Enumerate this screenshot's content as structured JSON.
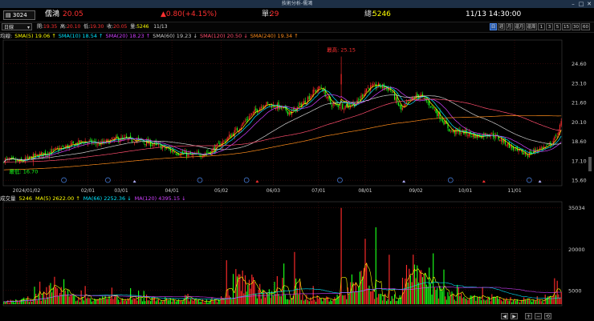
{
  "window": {
    "title": "技術分析-儒鴻",
    "buttons": [
      "–",
      "□",
      "✕"
    ]
  },
  "quote": {
    "symbol": "3024",
    "name": "儒鴻",
    "price": "20.05",
    "change": "▲0.80(+4.15%)",
    "unit_label": "單:",
    "unit_value": "29",
    "total_label": "總:",
    "total_value": "5246",
    "datetime": "11/13 14:30:00"
  },
  "ohlc": {
    "open_label": "開:",
    "open": "19.35",
    "high_label": "高:",
    "high": "20.10",
    "low_label": "低:",
    "low": "19.30",
    "close_label": "收:",
    "close": "20.05",
    "vol_label": "量:",
    "vol": "5246",
    "date": "11/13"
  },
  "toolbar": {
    "period": "日線",
    "period_arrow": "▾",
    "timeframes": [
      "日",
      "週",
      "月",
      "還月",
      "還周",
      "1",
      "3",
      "5",
      "15",
      "30",
      "60"
    ],
    "active": "日"
  },
  "price_legend": {
    "label": "均線:",
    "items": [
      {
        "text": "SMA(5) 19.06 ↑",
        "color": "#ffff00"
      },
      {
        "text": "SMA(10) 18.54 ↑",
        "color": "#00e5ff"
      },
      {
        "text": "SMA(20) 18.23 ↑",
        "color": "#d040ff"
      },
      {
        "text": "SMA(60) 19.23 ↓",
        "color": "#cccccc"
      },
      {
        "text": "SMA(120) 20.50 ↓",
        "color": "#ff4d6d"
      },
      {
        "text": "SMA(240) 19.34 ↑",
        "color": "#ff8c1a"
      }
    ]
  },
  "volume_legend": {
    "label": "成交量",
    "items": [
      {
        "text": "5246",
        "color": "#ffff00"
      },
      {
        "text": "MA(5) 2622.00 ↑",
        "color": "#ffff00"
      },
      {
        "text": "MA(66) 2252.36 ↓",
        "color": "#00e5ff"
      },
      {
        "text": "MA(120) 4395.15 ↓",
        "color": "#d040ff"
      }
    ]
  },
  "chart_data": [
    {
      "type": "candlestick",
      "title": "",
      "ylim": [
        15.3,
        26.3
      ],
      "yticks": [
        24.6,
        23.1,
        21.6,
        20.1,
        18.6,
        17.1,
        15.6
      ],
      "x_dates": [
        "2024/01/02",
        "02/01",
        "03/01",
        "04/01",
        "05/02",
        "06/03",
        "07/01",
        "08/01",
        "09/02",
        "10/01",
        "11/01"
      ],
      "annotations": {
        "max": "最高: 25.15",
        "min": "最低: 16.70"
      },
      "ma_colors": {
        "sma5": "#ffff00",
        "sma10": "#00e5ff",
        "sma20": "#d040ff",
        "sma60": "#cccccc",
        "sma120": "#ff4d6d",
        "sma240": "#ff8c1a"
      },
      "colors": {
        "up": "#ff2a2a",
        "down": "#1aff1a",
        "grid": "#5a1010",
        "axis_text": "#d0d0d0"
      },
      "anchors_close": [
        [
          0,
          17.2
        ],
        [
          12,
          17.0
        ],
        [
          22,
          17.4
        ],
        [
          35,
          17.8
        ],
        [
          48,
          18.2
        ],
        [
          60,
          18.6
        ],
        [
          72,
          18.4
        ],
        [
          85,
          18.8
        ],
        [
          100,
          18.7
        ],
        [
          115,
          18.3
        ],
        [
          128,
          17.8
        ],
        [
          142,
          17.5
        ],
        [
          155,
          17.8
        ],
        [
          165,
          18.6
        ],
        [
          175,
          19.5
        ],
        [
          185,
          20.6
        ],
        [
          195,
          21.5
        ],
        [
          205,
          21.3
        ],
        [
          215,
          20.8
        ],
        [
          225,
          21.6
        ],
        [
          232,
          22.4
        ],
        [
          238,
          22.8
        ],
        [
          245,
          21.5
        ],
        [
          255,
          21.3
        ],
        [
          265,
          21.6
        ],
        [
          272,
          22.7
        ],
        [
          282,
          22.9
        ],
        [
          290,
          22.6
        ],
        [
          298,
          21.0
        ],
        [
          305,
          21.8
        ],
        [
          312,
          22.2
        ],
        [
          320,
          21.4
        ],
        [
          328,
          20.4
        ],
        [
          335,
          19.4
        ],
        [
          345,
          19.3
        ],
        [
          355,
          19.0
        ],
        [
          365,
          19.2
        ],
        [
          375,
          18.6
        ],
        [
          385,
          17.8
        ],
        [
          393,
          17.6
        ],
        [
          400,
          18.0
        ],
        [
          408,
          18.2
        ],
        [
          414,
          18.9
        ],
        [
          418,
          20.0
        ]
      ],
      "volume": {
        "ylim": [
          0,
          37000
        ],
        "yticks": [
          35034,
          20000,
          5000
        ],
        "bars_anchor": [
          [
            0,
            800
          ],
          [
            15,
            1500
          ],
          [
            30,
            3000
          ],
          [
            36,
            7200
          ],
          [
            40,
            5600
          ],
          [
            55,
            1800
          ],
          [
            70,
            2500
          ],
          [
            90,
            1600
          ],
          [
            110,
            1900
          ],
          [
            130,
            1500
          ],
          [
            150,
            1200
          ],
          [
            160,
            1800
          ],
          [
            170,
            2200
          ],
          [
            178,
            9000
          ],
          [
            185,
            8200
          ],
          [
            190,
            5000
          ],
          [
            200,
            3500
          ],
          [
            220,
            2800
          ],
          [
            240,
            1800
          ],
          [
            255,
            3000
          ],
          [
            265,
            9500
          ],
          [
            270,
            13000
          ],
          [
            275,
            4500
          ],
          [
            285,
            2800
          ],
          [
            294,
            2200
          ],
          [
            300,
            6500
          ],
          [
            305,
            14000
          ],
          [
            312,
            9000
          ],
          [
            320,
            6000
          ],
          [
            330,
            3800
          ],
          [
            340,
            2400
          ],
          [
            360,
            1900
          ],
          [
            380,
            1700
          ],
          [
            395,
            1500
          ],
          [
            405,
            1200
          ],
          [
            418,
            5246
          ]
        ],
        "spikes": [
          [
            253,
            35034
          ],
          [
            218,
            19000
          ],
          [
            279,
            28000
          ],
          [
            289,
            18000
          ],
          [
            210,
            14800
          ],
          [
            167,
            16000
          ],
          [
            172,
            11000
          ]
        ]
      }
    }
  ],
  "bottom_buttons": [
    "◀",
    "▶",
    "+",
    "−",
    "⟲"
  ]
}
